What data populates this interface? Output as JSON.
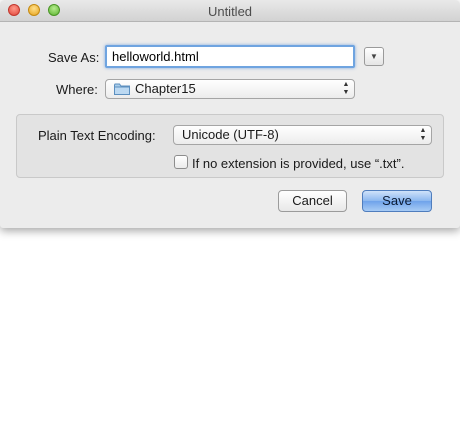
{
  "window": {
    "title": "Untitled"
  },
  "save_as": {
    "label": "Save As:",
    "value": "helloworld.html"
  },
  "where": {
    "label": "Where:",
    "value": "Chapter15",
    "icon": "folder-icon"
  },
  "encoding": {
    "label": "Plain Text Encoding:",
    "value": "Unicode (UTF-8)"
  },
  "extension_checkbox": {
    "label": "If no extension is provided, use “.txt”.",
    "checked": false
  },
  "buttons": {
    "cancel": "Cancel",
    "save": "Save"
  },
  "colors": {
    "accent": "#6fa4e0",
    "default_button": "#8bb7ef"
  }
}
